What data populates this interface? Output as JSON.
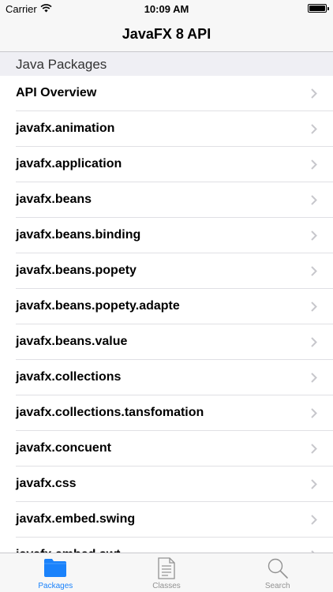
{
  "status_bar": {
    "carrier": "Carrier",
    "time": "10:09 AM"
  },
  "nav": {
    "title": "JavaFX 8 API"
  },
  "section": {
    "header": "Java Packages"
  },
  "packages": [
    "API Overview",
    "javafx.animation",
    "javafx.application",
    "javafx.beans",
    "javafx.beans.binding",
    "javafx.beans.popety",
    "javafx.beans.popety.adapte",
    "javafx.beans.value",
    "javafx.collections",
    "javafx.collections.tansfomation",
    "javafx.concuent",
    "javafx.css",
    "javafx.embed.swing",
    "javafx.embed.swt"
  ],
  "tabs": [
    {
      "label": "Packages",
      "icon": "folder-icon",
      "active": true
    },
    {
      "label": "Classes",
      "icon": "document-icon",
      "active": false
    },
    {
      "label": "Search",
      "icon": "search-icon",
      "active": false
    }
  ],
  "colors": {
    "accent": "#1a82fb",
    "inactive": "#929292"
  }
}
